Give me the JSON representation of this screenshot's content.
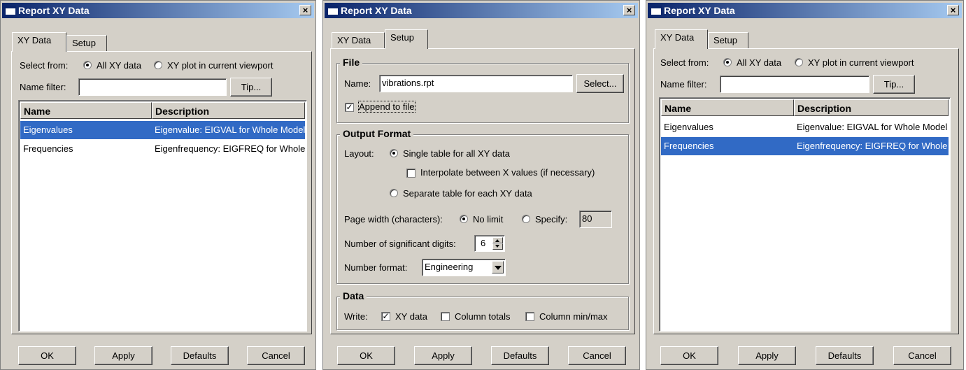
{
  "title": "Report XY Data",
  "close_glyph": "×",
  "tabs": {
    "xy": "XY Data",
    "setup": "Setup"
  },
  "select_from": {
    "label": "Select from:",
    "all": "All XY data",
    "plot": "XY plot in current viewport"
  },
  "name_filter": {
    "label": "Name filter:",
    "value": "",
    "tip": "Tip..."
  },
  "columns": {
    "name": "Name",
    "description": "Description"
  },
  "rows": [
    {
      "name": "Eigenvalues",
      "description": "Eigenvalue: EIGVAL for Whole Model"
    },
    {
      "name": "Frequencies",
      "description": "Eigenfrequency: EIGFREQ for Whole Model"
    }
  ],
  "footer": {
    "ok": "OK",
    "apply": "Apply",
    "defaults": "Defaults",
    "cancel": "Cancel"
  },
  "setup": {
    "file": {
      "title": "File",
      "name_label": "Name:",
      "name_value": "vibrations.rpt",
      "select": "Select...",
      "append": "Append to file",
      "append_checked": true
    },
    "output": {
      "title": "Output Format",
      "layout_label": "Layout:",
      "single": "Single table for all XY data",
      "interpolate": "Interpolate between X values (if necessary)",
      "separate": "Separate table for each XY data",
      "page_width_label": "Page width (characters):",
      "no_limit": "No limit",
      "specify": "Specify:",
      "specify_value": "80",
      "sig_digits_label": "Number of significant digits:",
      "sig_digits_value": "6",
      "number_format_label": "Number format:",
      "number_format_value": "Engineering"
    },
    "data": {
      "title": "Data",
      "write_label": "Write:",
      "xy": "XY data",
      "totals": "Column totals",
      "minmax": "Column min/max"
    }
  },
  "dialog1": {
    "selected_row": "Eigenvalues"
  },
  "dialog3": {
    "selected_row": "Frequencies"
  }
}
